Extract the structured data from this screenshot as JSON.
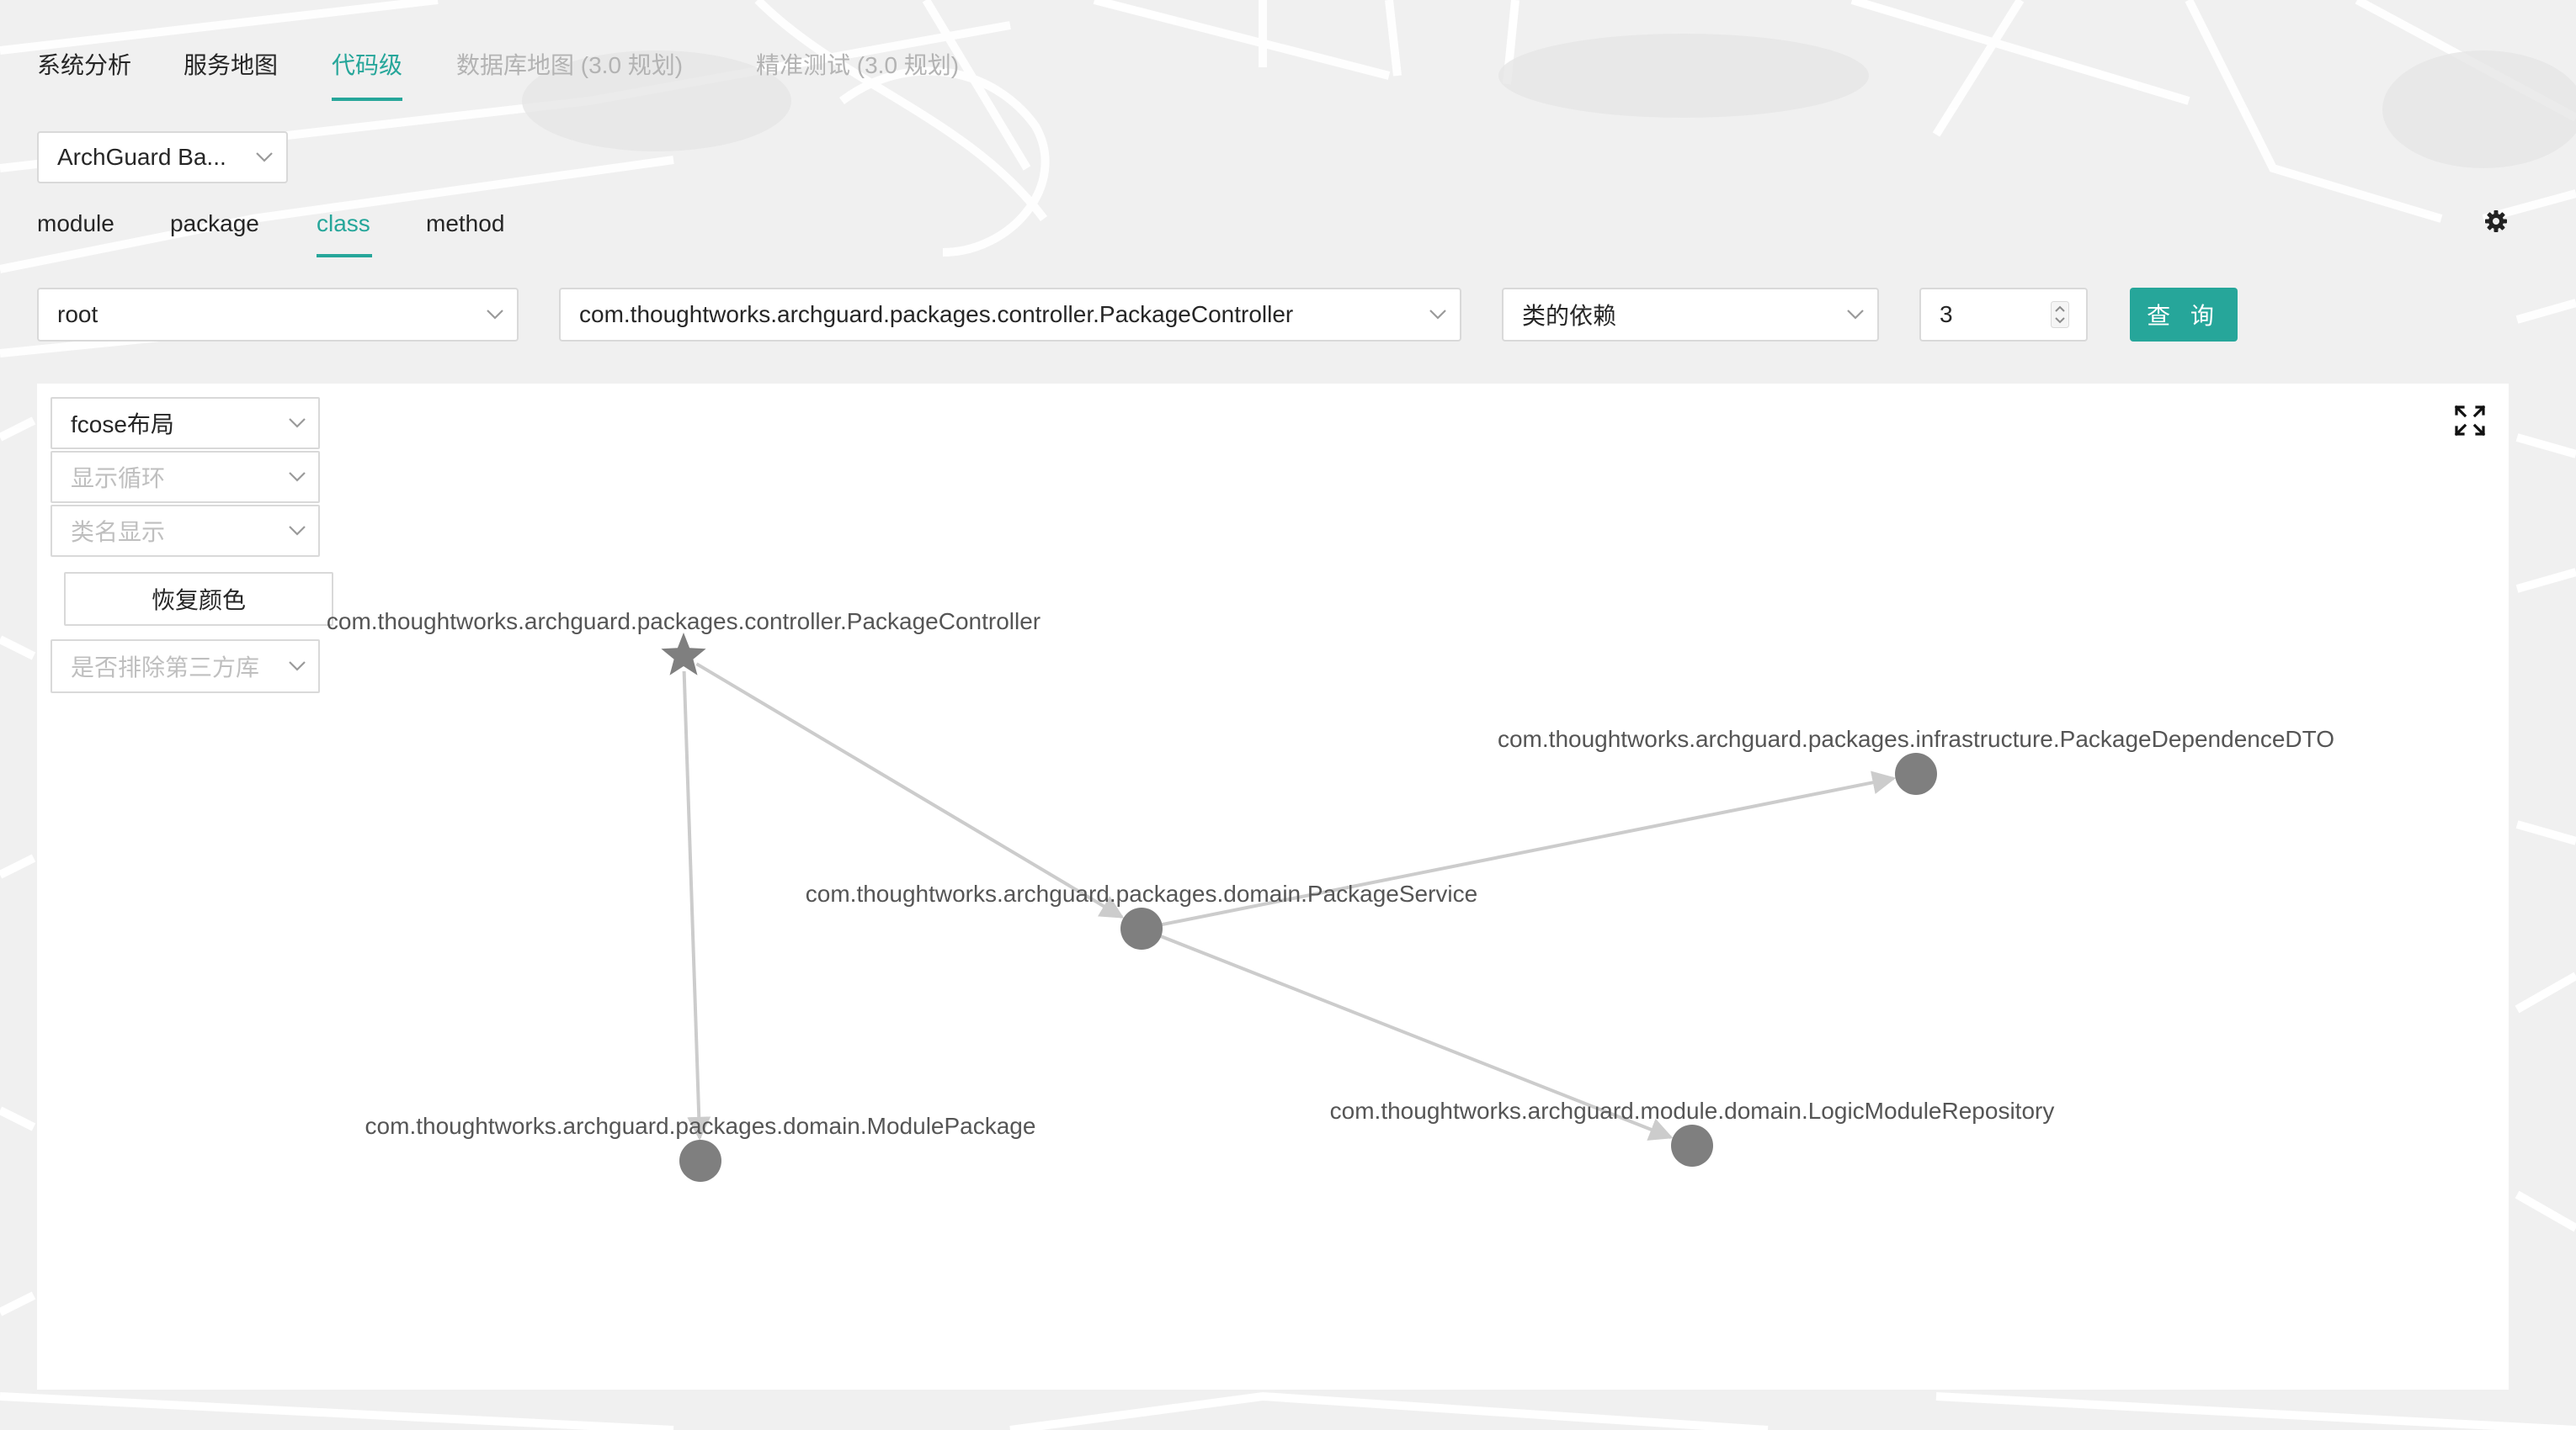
{
  "top_tabs": [
    {
      "label": "系统分析",
      "state": "normal"
    },
    {
      "label": "服务地图",
      "state": "normal"
    },
    {
      "label": "代码级",
      "state": "active"
    },
    {
      "label": "数据库地图 (3.0 规划)",
      "state": "disabled"
    },
    {
      "label": "精准测试 (3.0 规划)",
      "state": "disabled"
    }
  ],
  "system_select": {
    "value": "ArchGuard Ba..."
  },
  "level_tabs": [
    {
      "label": "module",
      "active": false
    },
    {
      "label": "package",
      "active": false
    },
    {
      "label": "class",
      "active": true
    },
    {
      "label": "method",
      "active": false
    }
  ],
  "query": {
    "module_value": "root",
    "class_value": "com.thoughtworks.archguard.packages.controller.PackageController",
    "dependency_type": "类的依赖",
    "depth": "3",
    "submit_label": "查 询"
  },
  "graph_controls": {
    "layout": "fcose布局",
    "show_cycle_placeholder": "显示循环",
    "class_name_display_placeholder": "类名显示",
    "reset_color_label": "恢复颜色",
    "exclude_third_party_placeholder": "是否排除第三方库"
  },
  "graph": {
    "nodes": [
      {
        "id": "controller",
        "label": "com.thoughtworks.archguard.packages.controller.PackageController",
        "shape": "star"
      },
      {
        "id": "service",
        "label": "com.thoughtworks.archguard.packages.domain.PackageService",
        "shape": "circle"
      },
      {
        "id": "dto",
        "label": "com.thoughtworks.archguard.packages.infrastructure.PackageDependenceDTO",
        "shape": "circle"
      },
      {
        "id": "modulepkg",
        "label": "com.thoughtworks.archguard.packages.domain.ModulePackage",
        "shape": "circle"
      },
      {
        "id": "repo",
        "label": "com.thoughtworks.archguard.module.domain.LogicModuleRepository",
        "shape": "circle"
      }
    ],
    "edges": [
      {
        "from": "controller",
        "to": "service"
      },
      {
        "from": "controller",
        "to": "modulepkg"
      },
      {
        "from": "service",
        "to": "dto"
      },
      {
        "from": "service",
        "to": "repo"
      }
    ],
    "node_color": "#7f7f7f",
    "edge_color": "#cccccc"
  },
  "icons": {
    "settings": "gear-icon",
    "fullscreen": "expand-icon"
  },
  "colors": {
    "accent": "#26a69a"
  }
}
